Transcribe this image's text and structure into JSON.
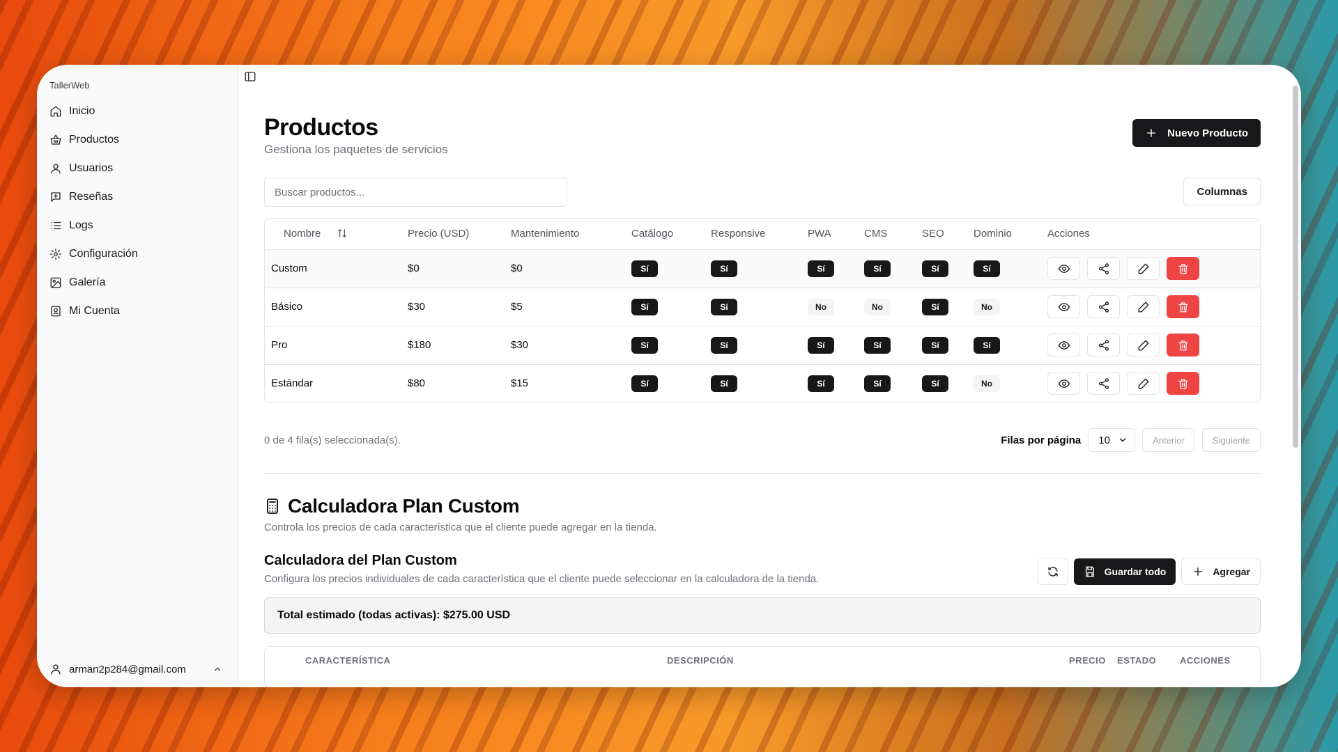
{
  "sidebar": {
    "brand": "TallerWeb",
    "items": [
      {
        "label": "Inicio",
        "icon": "home-icon"
      },
      {
        "label": "Productos",
        "icon": "basket-icon"
      },
      {
        "label": "Usuarios",
        "icon": "user-icon"
      },
      {
        "label": "Reseñas",
        "icon": "review-icon"
      },
      {
        "label": "Logs",
        "icon": "list-icon"
      },
      {
        "label": "Configuración",
        "icon": "gear-icon"
      },
      {
        "label": "Galería",
        "icon": "image-icon"
      },
      {
        "label": "Mi Cuenta",
        "icon": "account-icon"
      }
    ],
    "user_email": "arman2p284@gmail.com"
  },
  "header": {
    "title": "Productos",
    "subtitle": "Gestiona los paquetes de servicios",
    "new_button": "Nuevo Producto"
  },
  "toolbar": {
    "search_placeholder": "Buscar productos...",
    "columns_button": "Columnas"
  },
  "table": {
    "headers": [
      "Nombre",
      "Precio (USD)",
      "Mantenimiento",
      "Catálogo",
      "Responsive",
      "PWA",
      "CMS",
      "SEO",
      "Dominio",
      "Acciones"
    ],
    "rows": [
      {
        "nombre": "Custom",
        "precio": "$0",
        "mantenimiento": "$0",
        "catalogo": "Sí",
        "responsive": "Sí",
        "pwa": "Sí",
        "cms": "Sí",
        "seo": "Sí",
        "dominio": "Sí"
      },
      {
        "nombre": "Básico",
        "precio": "$30",
        "mantenimiento": "$5",
        "catalogo": "Sí",
        "responsive": "Sí",
        "pwa": "No",
        "cms": "No",
        "seo": "Sí",
        "dominio": "No"
      },
      {
        "nombre": "Pro",
        "precio": "$180",
        "mantenimiento": "$30",
        "catalogo": "Sí",
        "responsive": "Sí",
        "pwa": "Sí",
        "cms": "Sí",
        "seo": "Sí",
        "dominio": "Sí"
      },
      {
        "nombre": "Estándar",
        "precio": "$80",
        "mantenimiento": "$15",
        "catalogo": "Sí",
        "responsive": "Sí",
        "pwa": "Sí",
        "cms": "Sí",
        "seo": "Sí",
        "dominio": "No"
      }
    ]
  },
  "pagination": {
    "selection_text": "0 de 4 fila(s) seleccionada(s).",
    "rows_per_page_label": "Filas por página",
    "rows_per_page_value": "10",
    "prev": "Anterior",
    "next": "Siguiente"
  },
  "calculator": {
    "section_title": "Calculadora Plan Custom",
    "section_subtitle": "Controla los precios de cada característica que el cliente puede agregar en la tienda.",
    "card_title": "Calculadora del Plan Custom",
    "card_subtitle": "Configura los precios individuales de cada característica que el cliente puede seleccionar en la calculadora de la tienda.",
    "save_all": "Guardar todo",
    "add": "Agregar",
    "total_text": "Total estimado (todas activas): $275.00 USD",
    "columns": [
      "CARACTERÍSTICA",
      "DESCRIPCIÓN",
      "PRECIO",
      "ESTADO",
      "ACCIONES"
    ]
  },
  "colors": {
    "primary": "#18181b",
    "danger": "#ef4444",
    "muted": "#71717a",
    "border": "#e4e4e7"
  }
}
